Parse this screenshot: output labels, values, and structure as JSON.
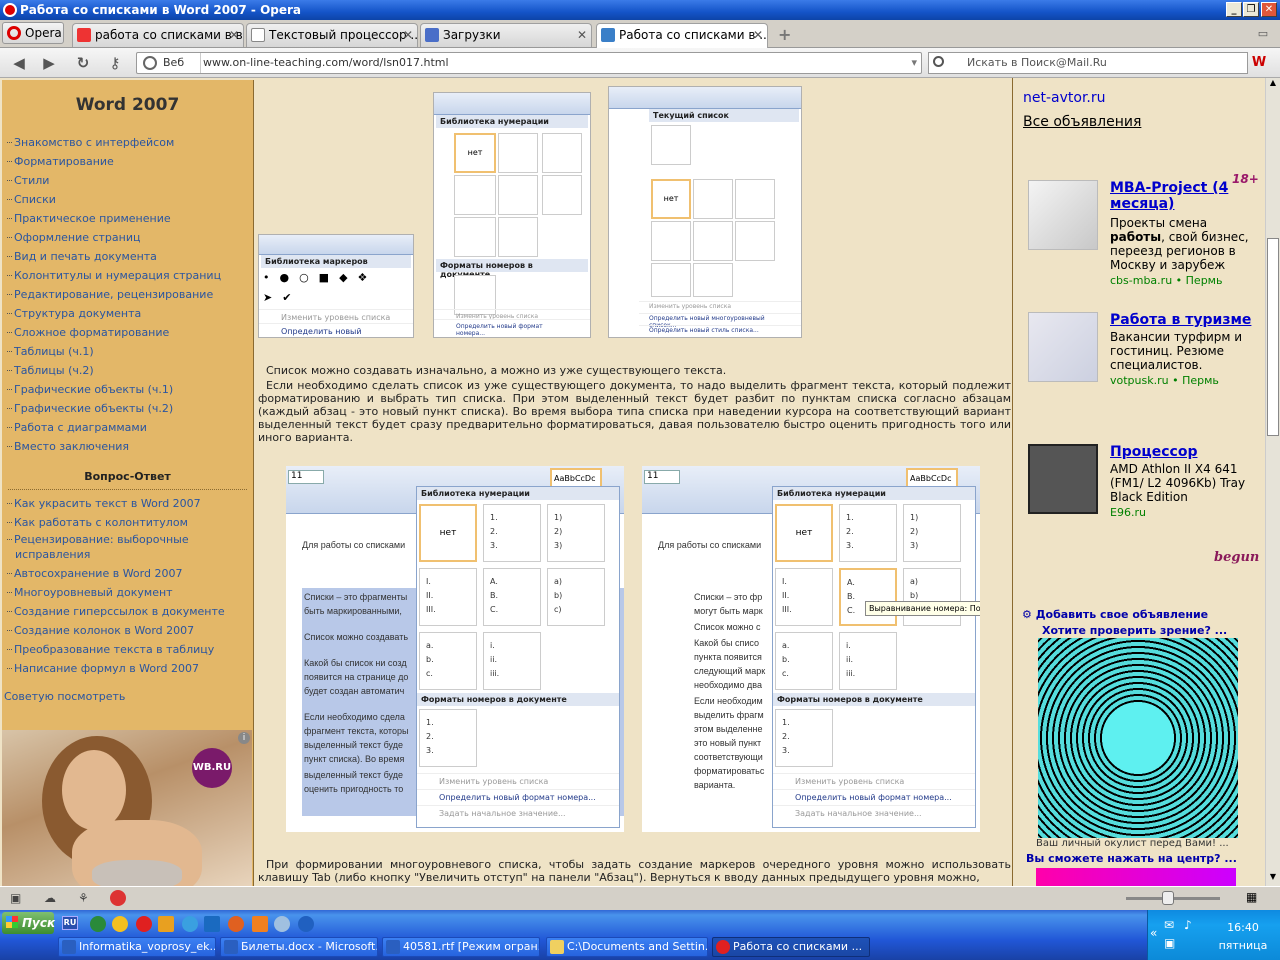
{
  "window": {
    "title": "Работа со списками в Word 2007 - Opera",
    "min": "_",
    "max": "❐",
    "close": "✕"
  },
  "tabs": {
    "opera_label": "Opera",
    "items": [
      {
        "label": "работа со списками в в..."
      },
      {
        "label": "Текстовый процессор ..."
      },
      {
        "label": "Загрузки"
      },
      {
        "label": "Работа со списками в ..."
      }
    ],
    "add": "+"
  },
  "nav": {
    "web_label": "Веб",
    "url": "www.on-line-teaching.com/word/lsn017.html",
    "search_placeholder": "Искать в Поиск@Mail.Ru"
  },
  "sidebar": {
    "title": "Word 2007",
    "items": [
      {
        "label": "Знакомство с интерфейсом"
      },
      {
        "label": "Форматирование"
      },
      {
        "label": "Стили"
      },
      {
        "label": "Списки"
      },
      {
        "label": "Практическое применение"
      },
      {
        "label": "Оформление страниц"
      },
      {
        "label": "Вид и печать документа"
      },
      {
        "label": "Колонтитулы и нумерация страниц"
      },
      {
        "label": "Редактирование, рецензирование"
      },
      {
        "label": "Структура документа"
      },
      {
        "label": "Сложное форматирование"
      },
      {
        "label": "Таблицы (ч.1)"
      },
      {
        "label": "Таблицы (ч.2)"
      },
      {
        "label": "Графические объекты (ч.1)"
      },
      {
        "label": "Графические объекты (ч.2)"
      },
      {
        "label": "Работа с диаграммами"
      },
      {
        "label": "Вместо заключения"
      }
    ],
    "qa_title": "Вопрос-Ответ",
    "qa_items": [
      {
        "label": "Как украсить текст в Word 2007"
      },
      {
        "label": "Как работать с колонтитулом"
      },
      {
        "label": "Рецензирование: выборочные исправления"
      },
      {
        "label": "Автосохранение в Word 2007"
      },
      {
        "label": "Многоуровневый документ"
      },
      {
        "label": "Создание гиперссылок в документе"
      },
      {
        "label": "Создание колонок в Word 2007"
      },
      {
        "label": "Преобразование текста в таблицу"
      },
      {
        "label": "Написание формул в Word 2007"
      }
    ],
    "advice": "Советую посмотреть",
    "ad_badge": "WB.RU"
  },
  "main": {
    "p1": "Список можно создавать изначально, а можно из уже существующего текста.",
    "p2": "Если необходимо сделать список из уже существующего документа, то надо выделить фрагмент текста, который подлежит форматированию и выбрать тип списка. При этом выделенный текст будет разбит по пунктам списка согласно абзацам (каждый абзац - это новый пункт списка). Во время выбора типа списка при наведении курсора на соответствующий вариант выделенный текст будет сразу предварительно форматироваться, давая пользователю быстро оценить пригодность того или иного варианта.",
    "p3": "При формировании многоуровневого списка, чтобы задать создание маркеров очередного уровня можно использовать клавишу Tab (либо кнопку \"Увеличить отступ\" на панели \"Абзац\"). Вернуться к вводу данных предыдущего уровня можно,",
    "shots": {
      "marker_lib": "Библиотека маркеров",
      "num_lib": "Библиотека нумерации",
      "doc_formats": "Форматы номеров в документе",
      "current_list": "Текущий список",
      "none": "нет",
      "change_level": "Изменить уровень списка",
      "define_marker": "Определить новый маркер...",
      "define_format": "Определить новый формат номера...",
      "set_start": "Задать начальное значение...",
      "define_multi": "Определить новый многоуровневый список...",
      "define_style": "Определить новый стиль списка...",
      "styles_label": "AaBbCcDc",
      "font_size": "11",
      "tooltip": "Выравнивание номера: По...",
      "doc_lines_left": [
        "Для работы со списками",
        "Списки – это фрагменты",
        "быть маркированными,",
        "Список можно создавать",
        "Какой бы список ни созд",
        "появится на странице до",
        "будет создан автоматич",
        "Если необходимо сдела",
        "фрагмент текста, которы",
        "выделенный текст буде",
        "пункт списка). Во время",
        "выделенный текст буде",
        "оценить пригодность то"
      ],
      "doc_lines_right": [
        "Для работы со списками",
        "Списки – это фр",
        "могут быть марк",
        "Список можно с",
        "Какой бы списо",
        "пункта появится",
        "следующий марк",
        "необходимо два",
        "Если необходим",
        "выделить фрагм",
        "этом выделенне",
        "это новый пункт",
        "соответствующи",
        "форматироватьс",
        "варианта."
      ]
    }
  },
  "right": {
    "link1": "net-avtor.ru",
    "link2": "Все объявления",
    "age": "18+",
    "ads": [
      {
        "title": "MBA-Project (4 месяца)",
        "desc_pre": "Проекты смена ",
        "desc_bold": "работы",
        "desc_post": ", свой бизнес, переезд регионов в Москву и зарубеж",
        "src": "cbs-mba.ru",
        "city": "Пермь"
      },
      {
        "title": "Работа в туризме",
        "desc": "Вакансии турфирм и гостиниц. Резюме специалистов.",
        "src": "votpusk.ru",
        "city": "Пермь"
      },
      {
        "title": "Процессор",
        "desc": "AMD Athlon II X4 641 (FM1/ L2 4096Kb) Tray Black Edition",
        "src": "E96.ru",
        "city": ""
      }
    ],
    "begun": "begun",
    "add_ad": "Добавить свое объявление",
    "vision_q": "Хотите проверить зрение? ...",
    "vision_caption": "Ваш личный окулист перед Вами! ...",
    "vision_q2": "Вы сможете нажать на центр? ..."
  },
  "taskbar": {
    "start": "Пуск",
    "lang": "RU",
    "tasks": [
      {
        "label": "Informatika_voprosy_ek..."
      },
      {
        "label": "Билеты.docx - Microsoft..."
      },
      {
        "label": "40581.rtf [Режим огран..."
      },
      {
        "label": "C:\\Documents and Settin..."
      },
      {
        "label": "Работа со списками ..."
      }
    ],
    "time": "16:40",
    "day": "пятница"
  }
}
